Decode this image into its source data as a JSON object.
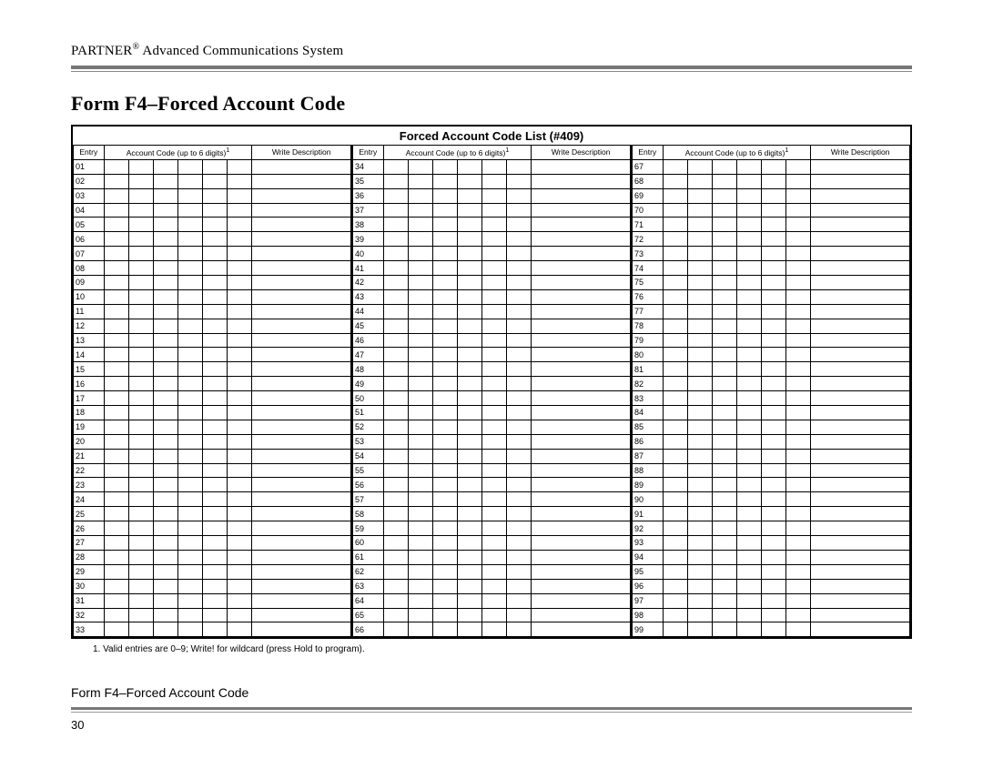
{
  "header": {
    "product": "PARTNER",
    "reg": "®",
    "subtitle": "Advanced Communications System"
  },
  "form": {
    "title": "Form F4–Forced Account Code",
    "list_title": "Forced Account Code List (#409)",
    "col_header_entry": "Entry",
    "col_header_code": "Account Code (up to 6 digits)",
    "col_header_code_sup": "1",
    "col_header_desc": "Write Description"
  },
  "columns": [
    {
      "entries": [
        "01",
        "02",
        "03",
        "04",
        "05",
        "06",
        "07",
        "08",
        "09",
        "10",
        "11",
        "12",
        "13",
        "14",
        "15",
        "16",
        "17",
        "18",
        "19",
        "20",
        "21",
        "22",
        "23",
        "24",
        "25",
        "26",
        "27",
        "28",
        "29",
        "30",
        "31",
        "32",
        "33"
      ]
    },
    {
      "entries": [
        "34",
        "35",
        "36",
        "37",
        "38",
        "39",
        "40",
        "41",
        "42",
        "43",
        "44",
        "45",
        "46",
        "47",
        "48",
        "49",
        "50",
        "51",
        "52",
        "53",
        "54",
        "55",
        "56",
        "57",
        "58",
        "59",
        "60",
        "61",
        "62",
        "63",
        "64",
        "65",
        "66"
      ]
    },
    {
      "entries": [
        "67",
        "68",
        "69",
        "70",
        "71",
        "72",
        "73",
        "74",
        "75",
        "76",
        "77",
        "78",
        "79",
        "80",
        "81",
        "82",
        "83",
        "84",
        "85",
        "86",
        "87",
        "88",
        "89",
        "90",
        "91",
        "92",
        "93",
        "94",
        "95",
        "96",
        "97",
        "98",
        "99"
      ]
    }
  ],
  "footnote": "1.   Valid entries are 0–9; Write! for wildcard (press Hold to program).",
  "footer": {
    "title": "Form F4–Forced Account Code",
    "page": "30"
  }
}
